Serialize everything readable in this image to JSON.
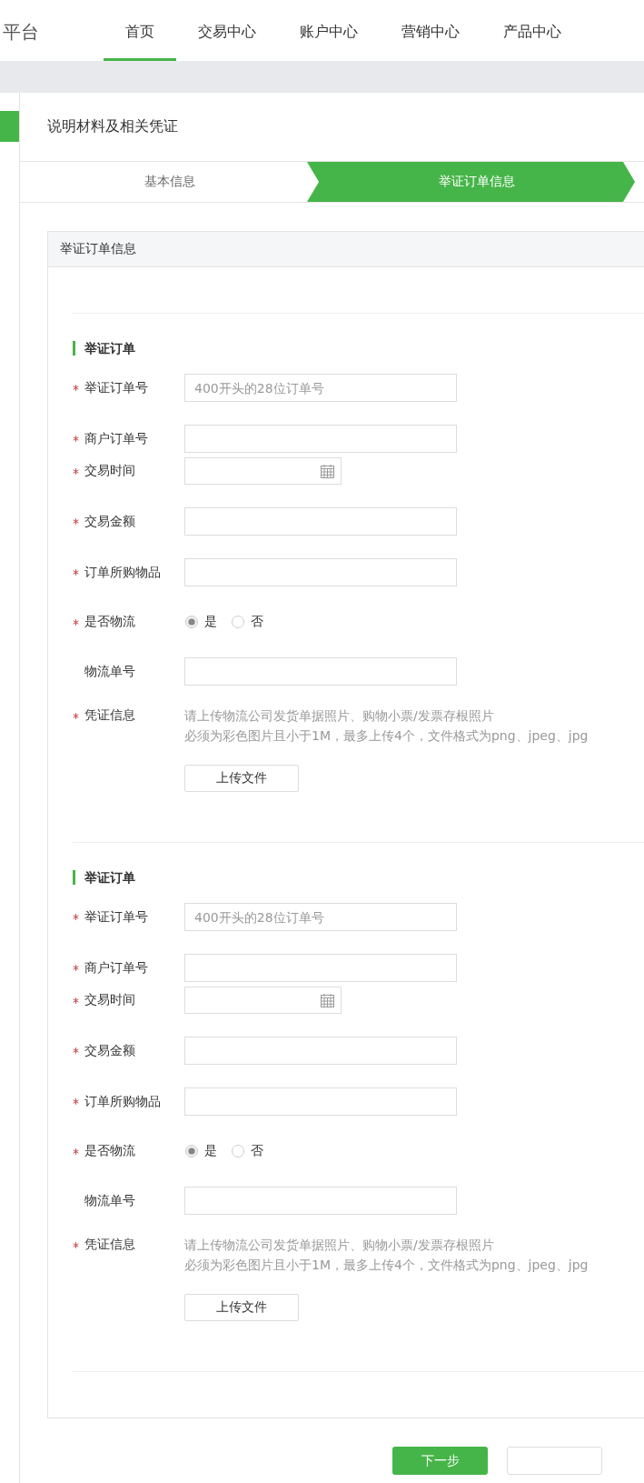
{
  "header": {
    "brand": "平台",
    "nav": [
      {
        "label": "首页",
        "selected": true
      },
      {
        "label": "交易中心",
        "selected": false
      },
      {
        "label": "账户中心",
        "selected": false
      },
      {
        "label": "营销中心",
        "selected": false
      },
      {
        "label": "产品中心",
        "selected": false
      }
    ]
  },
  "page": {
    "title": "说明材料及相关凭证"
  },
  "steps": [
    {
      "label": "基本信息",
      "selected": false
    },
    {
      "label": "举证订单信息",
      "selected": true
    }
  ],
  "panel": {
    "title": "举证订单信息",
    "sections": [
      {
        "title": "举证订单",
        "fields": [
          {
            "kind": "text",
            "label": "举证订单号",
            "required": true,
            "placeholder": "400开头的28位订单号"
          },
          {
            "kind": "text",
            "label": "商户订单号",
            "required": true
          },
          {
            "kind": "date",
            "label": "交易时间",
            "required": true
          },
          {
            "kind": "text",
            "label": "交易金额",
            "required": true
          },
          {
            "kind": "text",
            "label": "订单所购物品",
            "required": true
          },
          {
            "kind": "radio",
            "label": "是否物流",
            "required": true,
            "options": [
              {
                "label": "是",
                "selected": true
              },
              {
                "label": "否",
                "selected": false
              }
            ]
          },
          {
            "kind": "text",
            "label": "物流单号",
            "required": false
          },
          {
            "kind": "upload",
            "label": "凭证信息",
            "required": true,
            "hints": [
              "请上传物流公司发货单据照片、购物小票/发票存根照片",
              "必须为彩色图片且小于1M，最多上传4个，文件格式为png、jpeg、jpg"
            ],
            "button": "上传文件"
          }
        ]
      },
      {
        "title": "举证订单",
        "fields": [
          {
            "kind": "text",
            "label": "举证订单号",
            "required": true,
            "placeholder": "400开头的28位订单号"
          },
          {
            "kind": "text",
            "label": "商户订单号",
            "required": true
          },
          {
            "kind": "date",
            "label": "交易时间",
            "required": true
          },
          {
            "kind": "text",
            "label": "交易金额",
            "required": true
          },
          {
            "kind": "text",
            "label": "订单所购物品",
            "required": true
          },
          {
            "kind": "radio",
            "label": "是否物流",
            "required": true,
            "options": [
              {
                "label": "是",
                "selected": true
              },
              {
                "label": "否",
                "selected": false
              }
            ]
          },
          {
            "kind": "text",
            "label": "物流单号",
            "required": false
          },
          {
            "kind": "upload",
            "label": "凭证信息",
            "required": true,
            "hints": [
              "请上传物流公司发货单据照片、购物小票/发票存根照片",
              "必须为彩色图片且小于1M，最多上传4个，文件格式为png、jpeg、jpg"
            ],
            "button": "上传文件"
          }
        ]
      }
    ]
  },
  "buttons": [
    {
      "kind": "primary",
      "label": "下一步"
    },
    {
      "kind": "secondary"
    }
  ]
}
